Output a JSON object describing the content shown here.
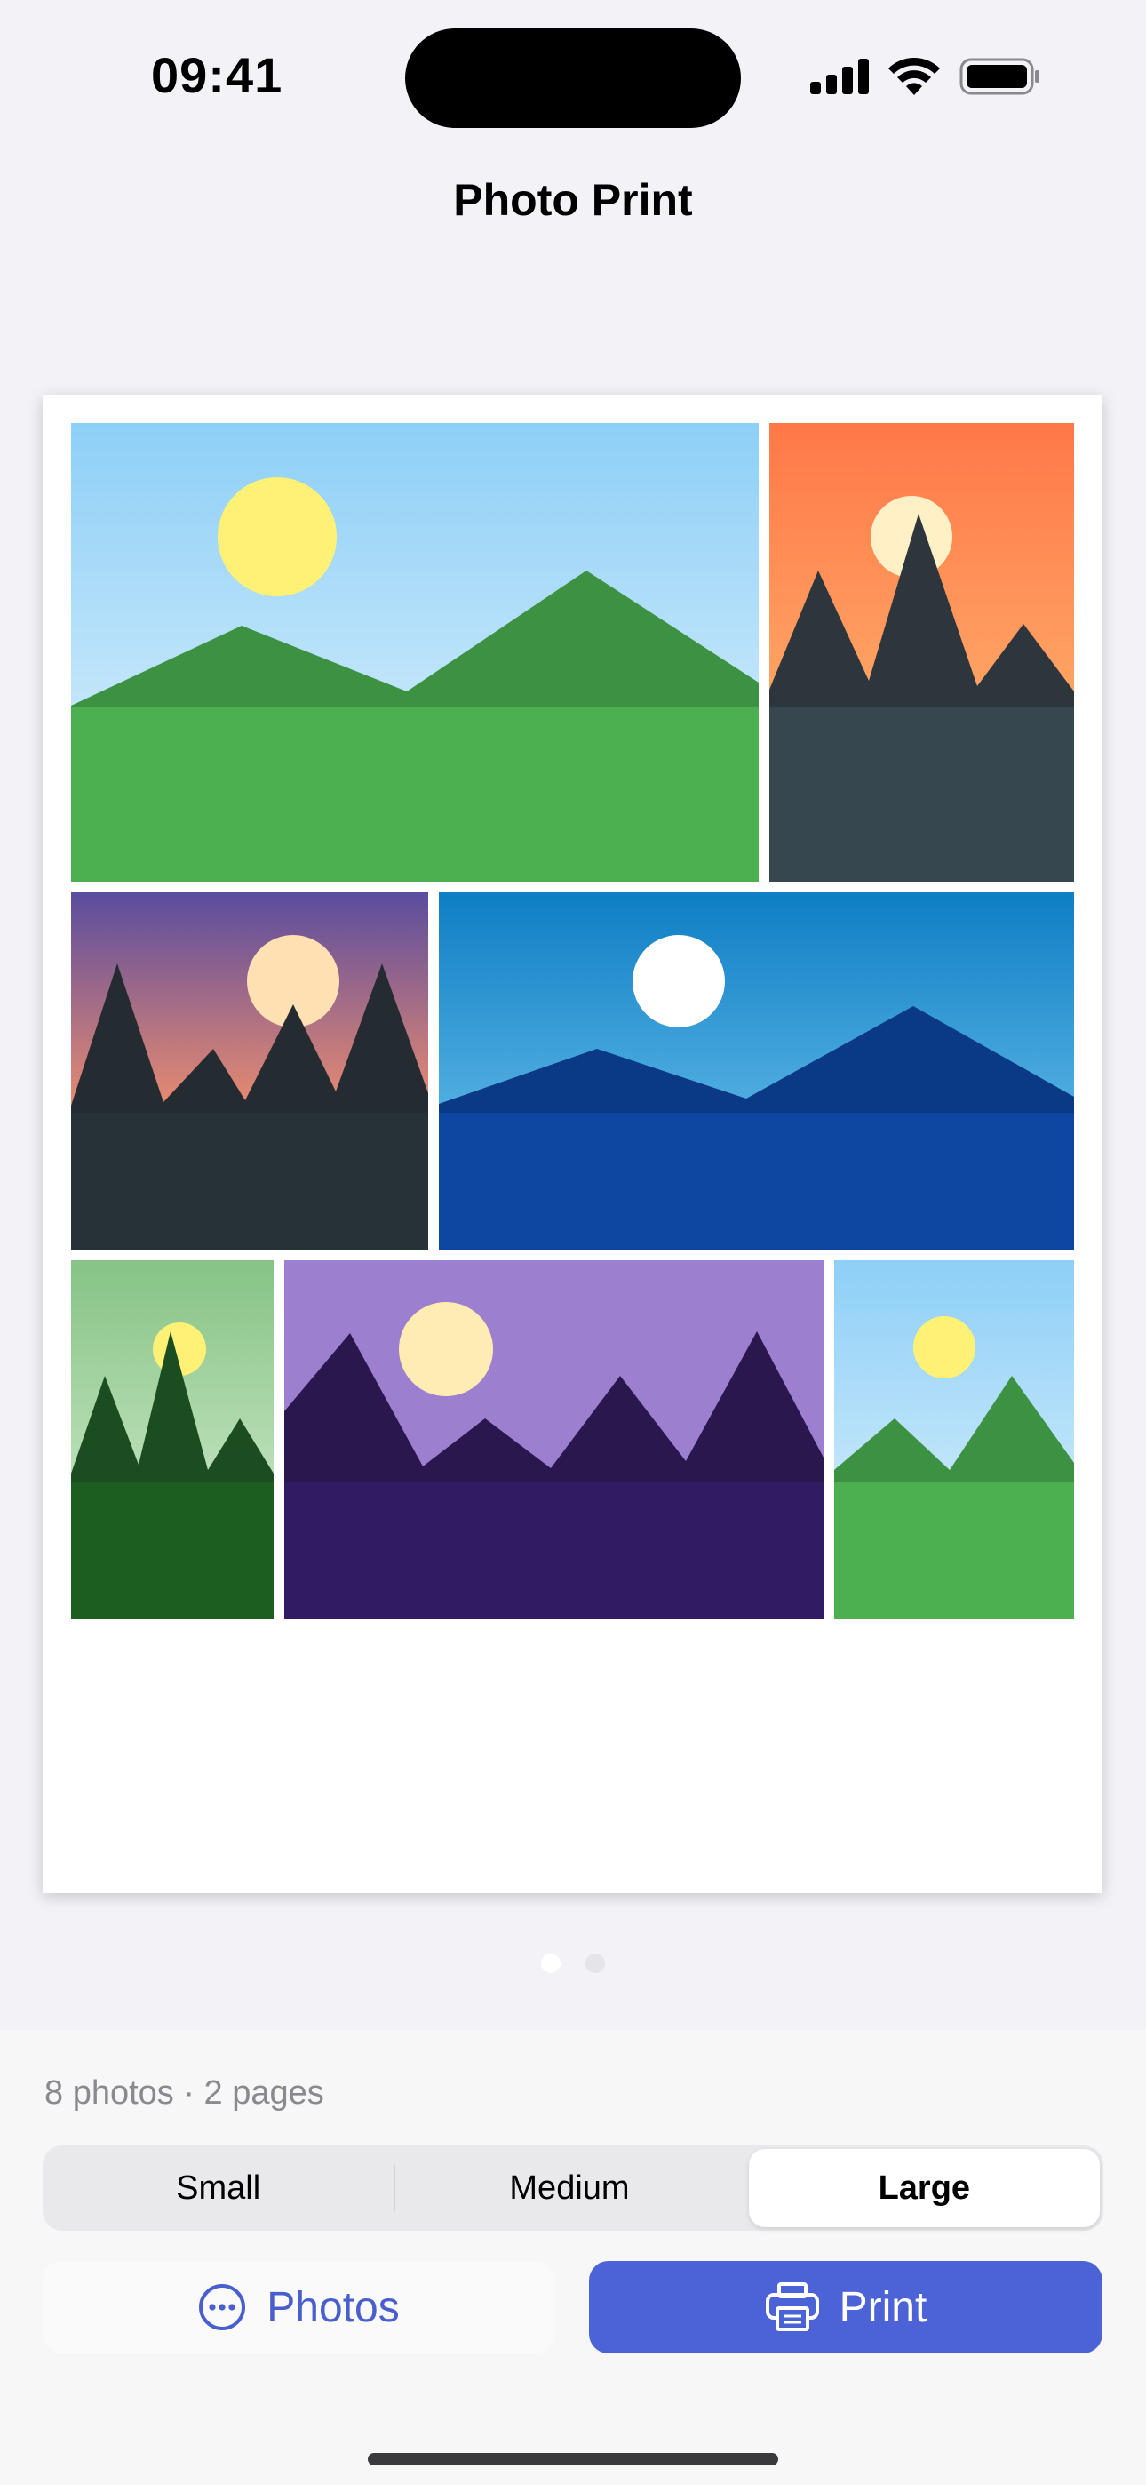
{
  "status_bar": {
    "time": "09:41"
  },
  "nav": {
    "title": "Photo Print"
  },
  "pager": {
    "current_page": 1,
    "total_pages": 2
  },
  "summary": {
    "text": "8 photos · 2 pages"
  },
  "size_control": {
    "options": [
      "Small",
      "Medium",
      "Large"
    ],
    "selected": "Large"
  },
  "actions": {
    "photos_label": "Photos",
    "print_label": "Print"
  },
  "colors": {
    "accent": "#4b63d6"
  }
}
